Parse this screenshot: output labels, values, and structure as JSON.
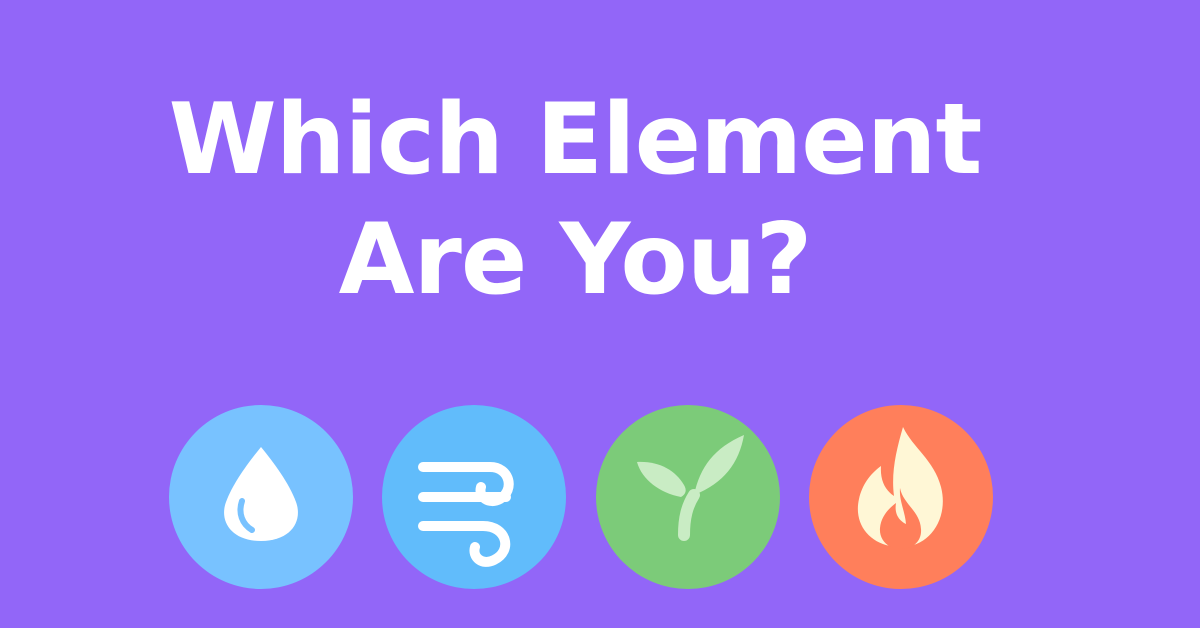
{
  "headline": {
    "line1": "Which Element",
    "line2": "Are You?"
  },
  "background_color": "#9266f8",
  "elements": [
    {
      "icon": "water-drop-icon",
      "circle_color": "#78c2ff",
      "glyph_color": "#ffffff"
    },
    {
      "icon": "wind-icon",
      "circle_color": "#61bcfb",
      "glyph_color": "#ffffff"
    },
    {
      "icon": "sprout-icon",
      "circle_color": "#7ccb79",
      "glyph_color": "#c9ecc4"
    },
    {
      "icon": "flame-icon",
      "circle_color": "#ff7f5b",
      "glyph_color": "#fff7d6"
    }
  ]
}
